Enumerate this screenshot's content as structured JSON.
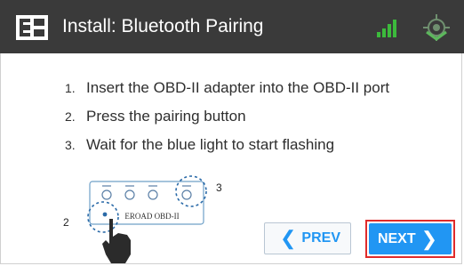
{
  "header": {
    "title": "Install: Bluetooth Pairing",
    "icons": [
      "eroad-logo-icon",
      "signal-strength-icon",
      "gps-icon"
    ],
    "colors": {
      "bar": "#3a3a3a",
      "signal": "#3cba3c",
      "gps": "#5cb85c"
    }
  },
  "steps": [
    {
      "num": "1.",
      "text": "Insert the OBD-II adapter into the OBD-II port"
    },
    {
      "num": "2.",
      "text": "Press the pairing button"
    },
    {
      "num": "3.",
      "text": "Wait for the blue light to start flashing"
    }
  ],
  "illustration": {
    "device_label": "EROAD OBD-II",
    "callout_button": "2",
    "callout_light": "3"
  },
  "buttons": {
    "prev": {
      "label": "PREV",
      "icon": "chevron-left-icon"
    },
    "next": {
      "label": "NEXT",
      "icon": "chevron-right-icon"
    }
  },
  "colors": {
    "accent": "#2196f3",
    "highlight": "#e02b2b"
  }
}
